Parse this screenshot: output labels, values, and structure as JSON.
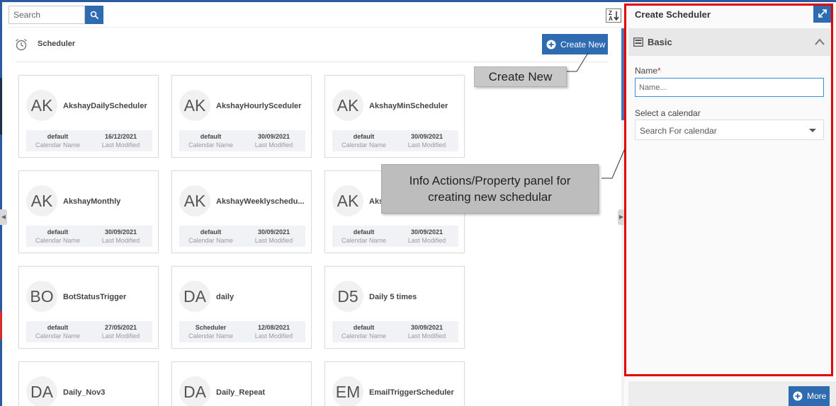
{
  "search": {
    "placeholder": "Search"
  },
  "header": {
    "title": "Scheduler",
    "create_new_label": "Create New"
  },
  "cards": [
    {
      "initials": "AK",
      "name": "AkshayDailyScheduler",
      "calendar": "default",
      "modified": "16/12/2021"
    },
    {
      "initials": "AK",
      "name": "AkshayHourlySceduler",
      "calendar": "default",
      "modified": "30/09/2021"
    },
    {
      "initials": "AK",
      "name": "AkshayMinScheduler",
      "calendar": "default",
      "modified": "30/09/2021"
    },
    {
      "initials": "AK",
      "name": "AkshayMonthly",
      "calendar": "default",
      "modified": "30/09/2021"
    },
    {
      "initials": "AK",
      "name": "AkshayWeeklyschedu...",
      "calendar": "default",
      "modified": "30/09/2021"
    },
    {
      "initials": "AK",
      "name": "Aks",
      "calendar": "default",
      "modified": "30/09/2021"
    },
    {
      "initials": "BO",
      "name": "BotStatusTrigger",
      "calendar": "default",
      "modified": "27/05/2021"
    },
    {
      "initials": "DA",
      "name": "daily",
      "calendar": "Scheduler",
      "modified": "12/08/2021"
    },
    {
      "initials": "D5",
      "name": "Daily 5 times",
      "calendar": "default",
      "modified": "30/09/2021"
    },
    {
      "initials": "DA",
      "name": "Daily_Nov3",
      "calendar": "",
      "modified": ""
    },
    {
      "initials": "DA",
      "name": "Daily_Repeat",
      "calendar": "",
      "modified": ""
    },
    {
      "initials": "EM",
      "name": "EmailTriggerScheduler",
      "calendar": "",
      "modified": ""
    }
  ],
  "card_labels": {
    "calendar_name": "Calendar Name",
    "last_modified": "Last Modified"
  },
  "callouts": {
    "create_new": "Create New",
    "info_line1": "Info Actions/Property panel for",
    "info_line2": "creating new schedular"
  },
  "panel": {
    "title": "Create Scheduler",
    "section": "Basic",
    "name_label": "Name",
    "required_mark": "*",
    "name_placeholder": "Name...",
    "calendar_label": "Select a calendar",
    "calendar_placeholder": "Search For calendar",
    "more_label": "More"
  },
  "colors": {
    "accent": "#2f6bb1",
    "highlight": "#e30000",
    "required": "#d32f2f"
  },
  "icons": {
    "search": "search-icon",
    "sort": "sort-az-icon",
    "clock": "alarm-clock-icon",
    "plus": "plus-circle-icon",
    "expand": "expand-icon",
    "section": "form-icon",
    "chevron": "chevron-up-icon",
    "caret": "caret-down-icon"
  }
}
